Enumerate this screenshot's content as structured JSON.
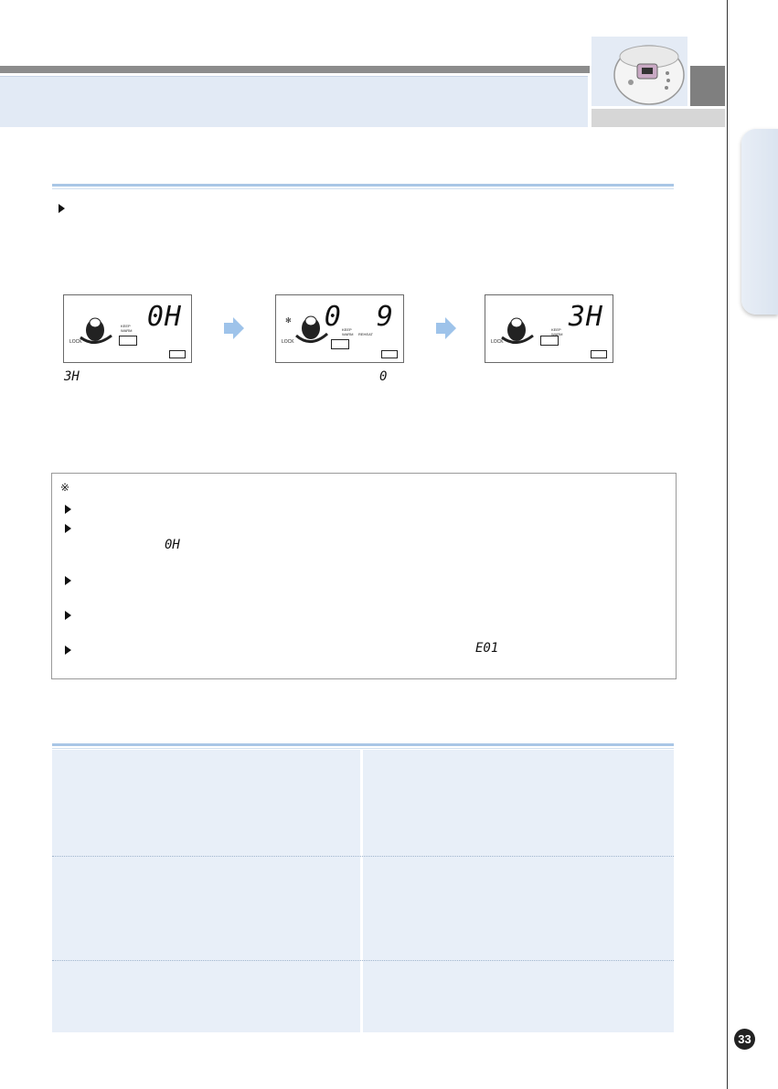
{
  "page": {
    "number": "33"
  },
  "header": {
    "photo_icon": "rice-cooker-photo"
  },
  "sections": [
    {
      "id": "display-sequence",
      "rule_color": "#a9c6e6"
    },
    {
      "id": "troubleshooting",
      "rule_color": "#a9c6e6"
    }
  ],
  "panels": [
    {
      "digits": "0H",
      "lock_label": "LOCK",
      "keep_label": "KEEP",
      "keep_sub": "WARM",
      "extra_label": ""
    },
    {
      "digits": "0  9",
      "lock_label": "LOCK",
      "keep_label": "KEEP",
      "keep_sub": "WARM",
      "extra_label": "REHEAT"
    },
    {
      "digits": "3H",
      "lock_label": "LOCK",
      "keep_label": "KEEP",
      "keep_sub": "WARM",
      "extra_label": ""
    }
  ],
  "captions": {
    "left": "3H",
    "middle": "0"
  },
  "notes": {
    "mark": "※",
    "segment_0H": "0H",
    "segment_E01": "E01"
  },
  "icons": {
    "arrow": "blue-right-arrow-icon",
    "bullet": "triangle-bullet-icon"
  },
  "colors": {
    "accent": "#a9c6e6",
    "band": "#e2eaf5",
    "table_bg": "#e8eff8"
  }
}
